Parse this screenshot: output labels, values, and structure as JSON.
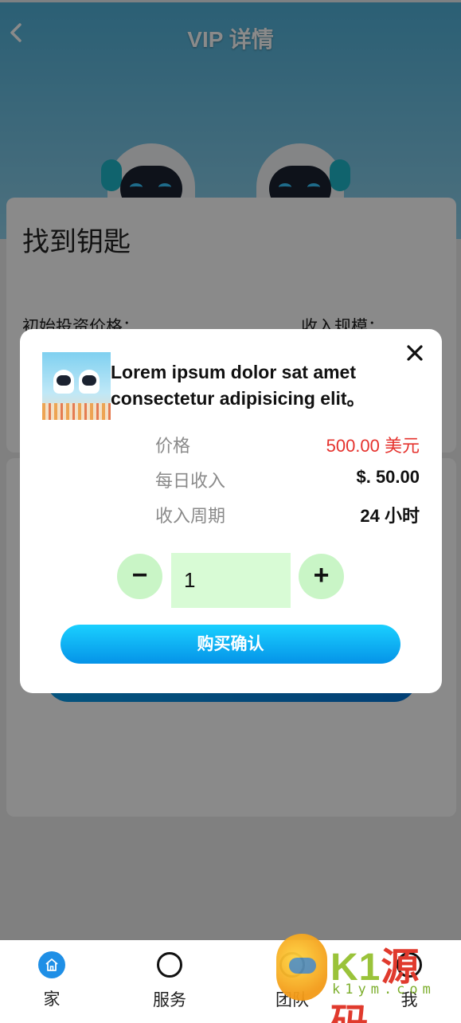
{
  "header": {
    "title": "VIP 详情",
    "back_icon": "chevron-left-icon"
  },
  "info_card": {
    "title": "找到钥匙",
    "initial_price_label": "初始投资价格：",
    "income_scale_label": "收入规模："
  },
  "modal": {
    "close_icon": "close-icon",
    "product_name": "Lorem ipsum dolor sat amet consectetur adipisicing elit。",
    "rows": [
      {
        "label": "价格",
        "value": "500.00 美元"
      },
      {
        "label": "每日收入",
        "value": "$. 50.00"
      },
      {
        "label": "收入周期",
        "value": "24 小时"
      }
    ],
    "quantity": "1",
    "minus_label": "−",
    "plus_label": "+",
    "confirm_label": "购买确认"
  },
  "nav": {
    "items": [
      {
        "label": "家",
        "icon": "home-icon",
        "active": true
      },
      {
        "label": "服务",
        "icon": "circle-icon"
      },
      {
        "label": "团队",
        "icon": "team-icon"
      },
      {
        "label": "我",
        "icon": "user-icon"
      }
    ]
  },
  "watermark": {
    "brand_prefix": "K1",
    "brand_suffix": "源码",
    "domain": "k1ym.com"
  },
  "colors": {
    "accent": "#1f8fe6",
    "price": "#e5322d",
    "stepper": "#c9f5c6",
    "confirm_start": "#1ad0ff",
    "confirm_end": "#0593e8"
  }
}
